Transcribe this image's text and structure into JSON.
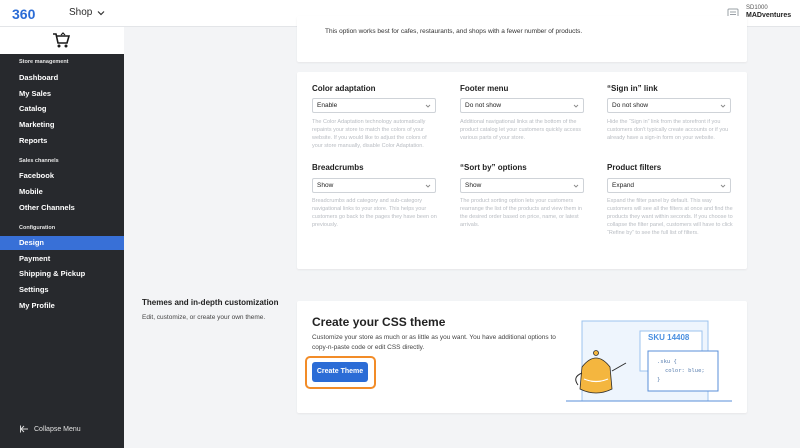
{
  "header": {
    "shop_label": "Shop",
    "store_id": "SD1000",
    "store_name": "MADventures"
  },
  "sidebar": {
    "sections": [
      {
        "title": "Store management",
        "items": [
          "Dashboard",
          "My Sales",
          "Catalog",
          "Marketing",
          "Reports"
        ]
      },
      {
        "title": "Sales channels",
        "items": [
          "Facebook",
          "Mobile",
          "Other Channels"
        ]
      },
      {
        "title": "Configuration",
        "items": [
          "Design",
          "Payment",
          "Shipping & Pickup",
          "Settings",
          "My Profile"
        ]
      }
    ],
    "active_item": "Design",
    "collapse_label": "Collapse Menu"
  },
  "top_card": {
    "note": "This option works best for cafes, restaurants, and shops with a fewer number of products."
  },
  "settings": [
    {
      "label": "Color adaptation",
      "value": "Enable",
      "help": "The Color Adaptation technology automatically repaints your store to match the colors of your website. If you would like to adjust the colors of your store manually, disable Color Adaptation."
    },
    {
      "label": "Footer menu",
      "value": "Do not show",
      "help": "Additional navigational links at the bottom of the product catalog let your customers quickly access various parts of your store."
    },
    {
      "label": "“Sign in” link",
      "value": "Do not show",
      "help": "Hide the “Sign in” link from the storefront if you customers don't typically create accounts or if you already have a sign-in form on your website."
    },
    {
      "label": "Breadcrumbs",
      "value": "Show",
      "help": "Breadcrumbs add category and sub-category navigational links to your store. This helps your customers go back to the pages they have been on previously."
    },
    {
      "label": "“Sort by” options",
      "value": "Show",
      "help": "The product sorting option lets your customers rearrange the list of the products and view them in the desired order based on price, name, or latest arrivals."
    },
    {
      "label": "Product filters",
      "value": "Expand",
      "help": "Expand the filter panel by default. This way customers will see all the filters at once and find the products they want within seconds. If you choose to collapse the filter panel, customers will have to click “Refine by” to see the full list of filters."
    }
  ],
  "themes_section": {
    "title": "Themes and in-depth customization",
    "description": "Edit, customize, or create your own theme."
  },
  "css_card": {
    "title": "Create your CSS theme",
    "description": "Customize your store as much or as little as you want. You have additional options to copy-n-paste code or edit CSS directly.",
    "button_label": "Create Theme",
    "sku_text": "SKU 14408",
    "code_line1": ".sku {",
    "code_line2": "color: blue;",
    "code_line3": "}"
  },
  "colors": {
    "accent": "#2b6cd6",
    "sidebar_bg": "#27292d",
    "active_nav": "#3870d7",
    "highlight_outline": "#f28c28"
  }
}
